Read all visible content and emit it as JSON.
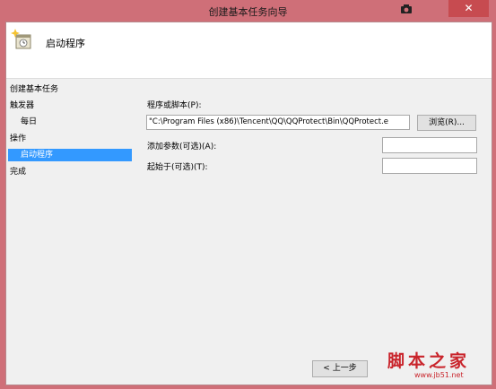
{
  "window": {
    "title": "创建基本任务向导",
    "close_glyph": "✕"
  },
  "header": {
    "title": "启动程序",
    "icon": "task-clock-icon"
  },
  "nav": {
    "items": [
      "创建基本任务",
      "触发器",
      "每日",
      "操作",
      "启动程序",
      "完成"
    ],
    "selected": "启动程序"
  },
  "form": {
    "program_label": "程序或脚本(P):",
    "program_value": "\"C:\\Program Files (x86)\\Tencent\\QQ\\QQProtect\\Bin\\QQProtect.e",
    "browse_label": "浏览(R)...",
    "args_label": "添加参数(可选)(A):",
    "args_value": "",
    "startin_label": "起始于(可选)(T):",
    "startin_value": ""
  },
  "footer": {
    "back_label": "< 上一步"
  },
  "watermark": {
    "text": "脚本之家",
    "url": "www.jb51.net"
  },
  "colors": {
    "titlebar": "#cf6f78",
    "close": "#c74b50",
    "selection": "#3399ff",
    "watermark": "#c9242b"
  }
}
